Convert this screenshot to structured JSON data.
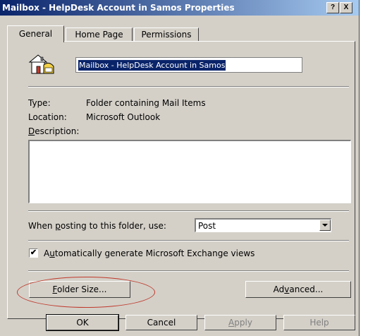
{
  "window": {
    "title": "Mailbox - HelpDesk Account in Samos Properties",
    "help_btn": "?",
    "close_btn": "X"
  },
  "tabs": [
    {
      "label": "General",
      "active": true
    },
    {
      "label": "Home Page",
      "active": false
    },
    {
      "label": "Permissions",
      "active": false
    }
  ],
  "general": {
    "folder_name": "Mailbox - HelpDesk Account in Samos",
    "type_label": "Type:",
    "type_value": "Folder containing Mail Items",
    "location_label": "Location:",
    "location_value": "Microsoft Outlook",
    "description_label_pre": "",
    "description_label_ul": "D",
    "description_label_post": "escription:",
    "description_value": "",
    "posting_label_pre": "When ",
    "posting_label_ul": "p",
    "posting_label_post": "osting to this folder, use:",
    "posting_value": "Post",
    "auto_views_pre": "A",
    "auto_views_ul": "u",
    "auto_views_post": "tomatically generate Microsoft Exchange views",
    "auto_views_checked": true,
    "checkmark": "✔",
    "folder_size_ul": "F",
    "folder_size_post": "older Size...",
    "advanced_pre": "Ad",
    "advanced_ul": "v",
    "advanced_post": "anced..."
  },
  "footer": {
    "ok": "OK",
    "cancel": "Cancel",
    "apply_ul": "A",
    "apply_post": "pply",
    "help": "Help"
  },
  "colors": {
    "titlebar_start": "#0a246a",
    "titlebar_end": "#a6caf0",
    "dialog_bg": "#d4d0c8",
    "highlight_circle": "#c0392b"
  }
}
